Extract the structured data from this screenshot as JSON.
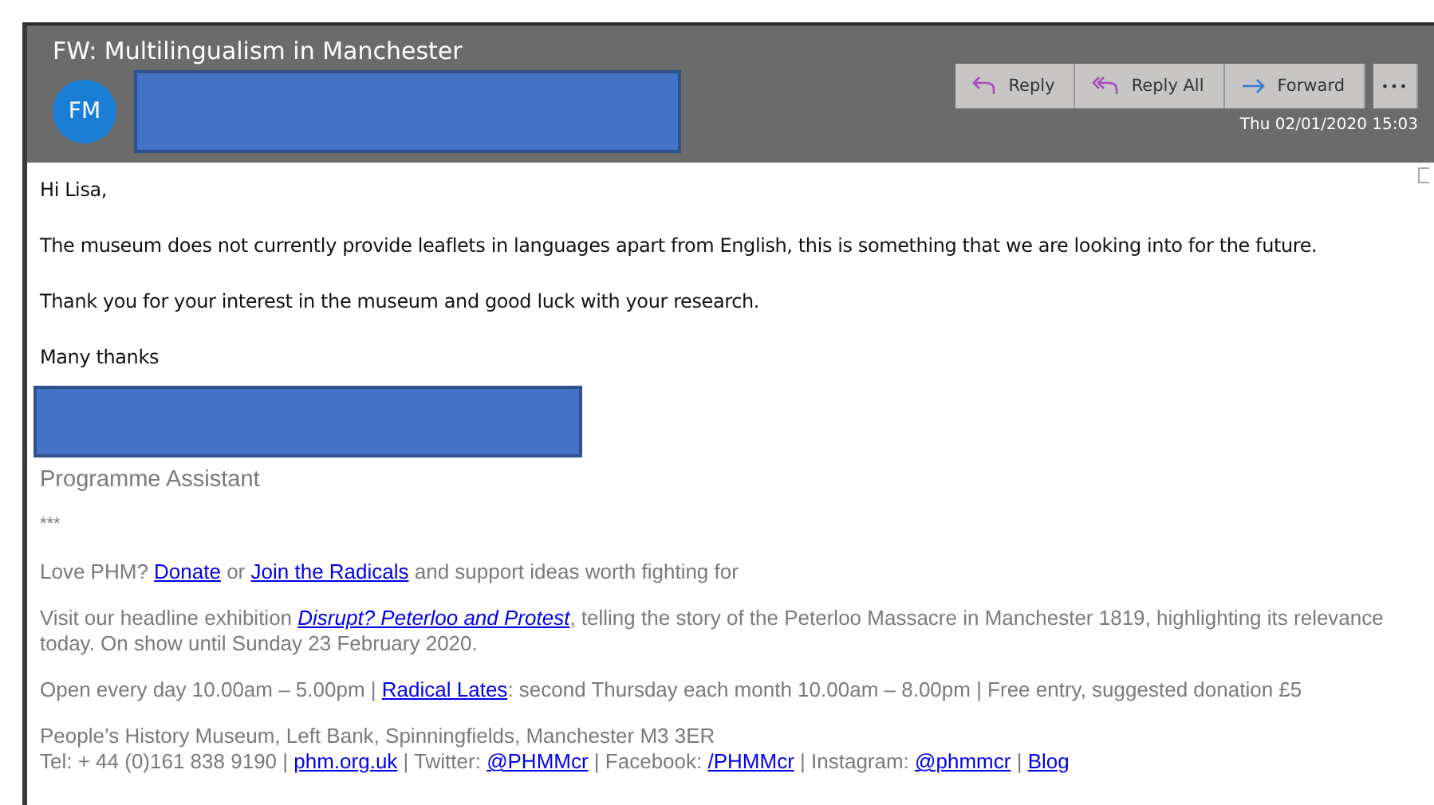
{
  "window": {
    "title": "FW: Multilingualism in Manchester"
  },
  "sender": {
    "initials": "FM",
    "redacted": true
  },
  "actions": [
    {
      "label": "Reply",
      "kind": "reply"
    },
    {
      "label": "Reply All",
      "kind": "reply-all"
    },
    {
      "label": "Forward",
      "kind": "forward"
    },
    {
      "label": "•••",
      "kind": "more"
    }
  ],
  "date": "Thu 02/01/2020 15:03",
  "body": {
    "greeting": "Hi Lisa,",
    "paragraphs": [
      "The museum does not currently provide leaflets in languages apart from English, this is something that we are looking into for the future.",
      "Thank you for your interest in the museum and good luck with your research.",
      "Many thanks"
    ],
    "signature_redacted": true,
    "job_title": "Programme Assistant",
    "separator": "***",
    "footer": [
      [
        {
          "kind": "text",
          "text": "Love PHM? "
        },
        {
          "kind": "link",
          "text": "Donate"
        },
        {
          "kind": "text",
          "text": " or "
        },
        {
          "kind": "link",
          "text": "Join the Radicals"
        },
        {
          "kind": "text",
          "text": " and support ideas worth fighting for"
        }
      ],
      [
        {
          "kind": "text",
          "text": "Visit our headline exhibition "
        },
        {
          "kind": "link-emphasis",
          "text": "Disrupt? Peterloo and Protest"
        },
        {
          "kind": "text",
          "text": ", telling the story of the Peterloo Massacre in Manchester 1819, highlighting its relevance today.  On show until Sunday 23 February 2020."
        }
      ],
      [
        {
          "kind": "text",
          "text": "Open every day 10.00am – 5.00pm | "
        },
        {
          "kind": "link",
          "text": "Radical Lates"
        },
        {
          "kind": "text",
          "text": ": second Thursday each month 10.00am – 8.00pm | Free entry, suggested donation £5"
        }
      ],
      [
        {
          "kind": "text",
          "text": "People’s History Museum, Left Bank, Spinningfields, Manchester M3 3ER"
        },
        {
          "kind": "break"
        },
        {
          "kind": "text",
          "text": "Tel: + 44 (0)161 838 9190 | "
        },
        {
          "kind": "link",
          "text": "phm.org.uk"
        },
        {
          "kind": "text",
          "text": " | Twitter: "
        },
        {
          "kind": "link",
          "text": "@PHMMcr"
        },
        {
          "kind": "text",
          "text": " | Facebook: "
        },
        {
          "kind": "link",
          "text": "/PHMMcr"
        },
        {
          "kind": "text",
          "text": " | Instagram: "
        },
        {
          "kind": "link",
          "text": "@phmmcr"
        },
        {
          "kind": "text",
          "text": " | "
        },
        {
          "kind": "link",
          "text": "Blog"
        }
      ]
    ]
  }
}
